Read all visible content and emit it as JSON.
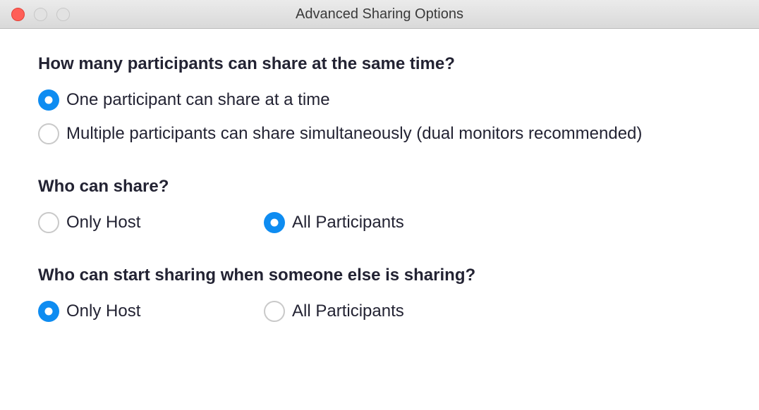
{
  "window": {
    "title": "Advanced Sharing Options"
  },
  "sections": {
    "howMany": {
      "title": "How many participants can share at the same time?",
      "options": {
        "one": {
          "label": "One participant can share at a time",
          "selected": true
        },
        "multiple": {
          "label": "Multiple participants can share simultaneously (dual monitors recommended)",
          "selected": false
        }
      }
    },
    "whoCanShare": {
      "title": "Who can share?",
      "options": {
        "onlyHost": {
          "label": "Only Host",
          "selected": false
        },
        "allParticipants": {
          "label": "All Participants",
          "selected": true
        }
      }
    },
    "whoCanStart": {
      "title": "Who can start sharing when someone else is sharing?",
      "options": {
        "onlyHost": {
          "label": "Only Host",
          "selected": true
        },
        "allParticipants": {
          "label": "All Participants",
          "selected": false
        }
      }
    }
  }
}
